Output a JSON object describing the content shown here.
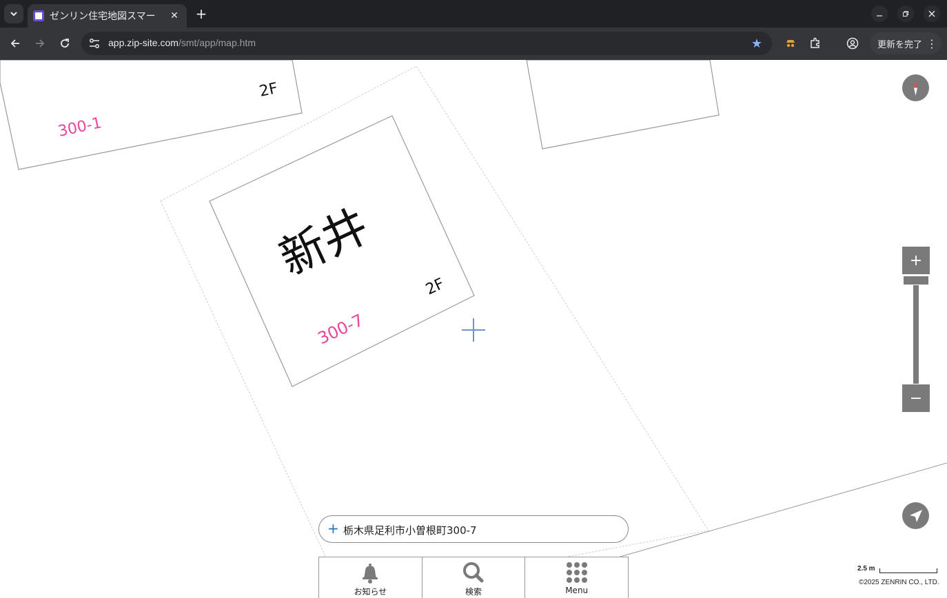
{
  "browser": {
    "tab_title": "ゼンリン住宅地図スマー",
    "url_host": "app.zip-site.com",
    "url_path": "/smt/app/map.htm",
    "update_label": "更新を完了"
  },
  "map": {
    "building_name": "新井",
    "lots": [
      {
        "number": "300-1",
        "floors": "2F"
      },
      {
        "number": "300-7",
        "floors": "2F"
      }
    ]
  },
  "address": {
    "text": "栃木県足利市小曽根町300-7"
  },
  "bottom_nav": [
    {
      "label": "お知らせ",
      "icon": "bell-icon"
    },
    {
      "label": "検索",
      "icon": "search-icon"
    },
    {
      "label": "Menu",
      "icon": "grid-menu-icon"
    }
  ],
  "scale": {
    "label": "2.5 m"
  },
  "copyright": "©2025 ZENRIN CO., LTD.",
  "colors": {
    "lot_number": "#e8479a",
    "control": "#7a7a7a",
    "accent": "#2a6fb8"
  }
}
